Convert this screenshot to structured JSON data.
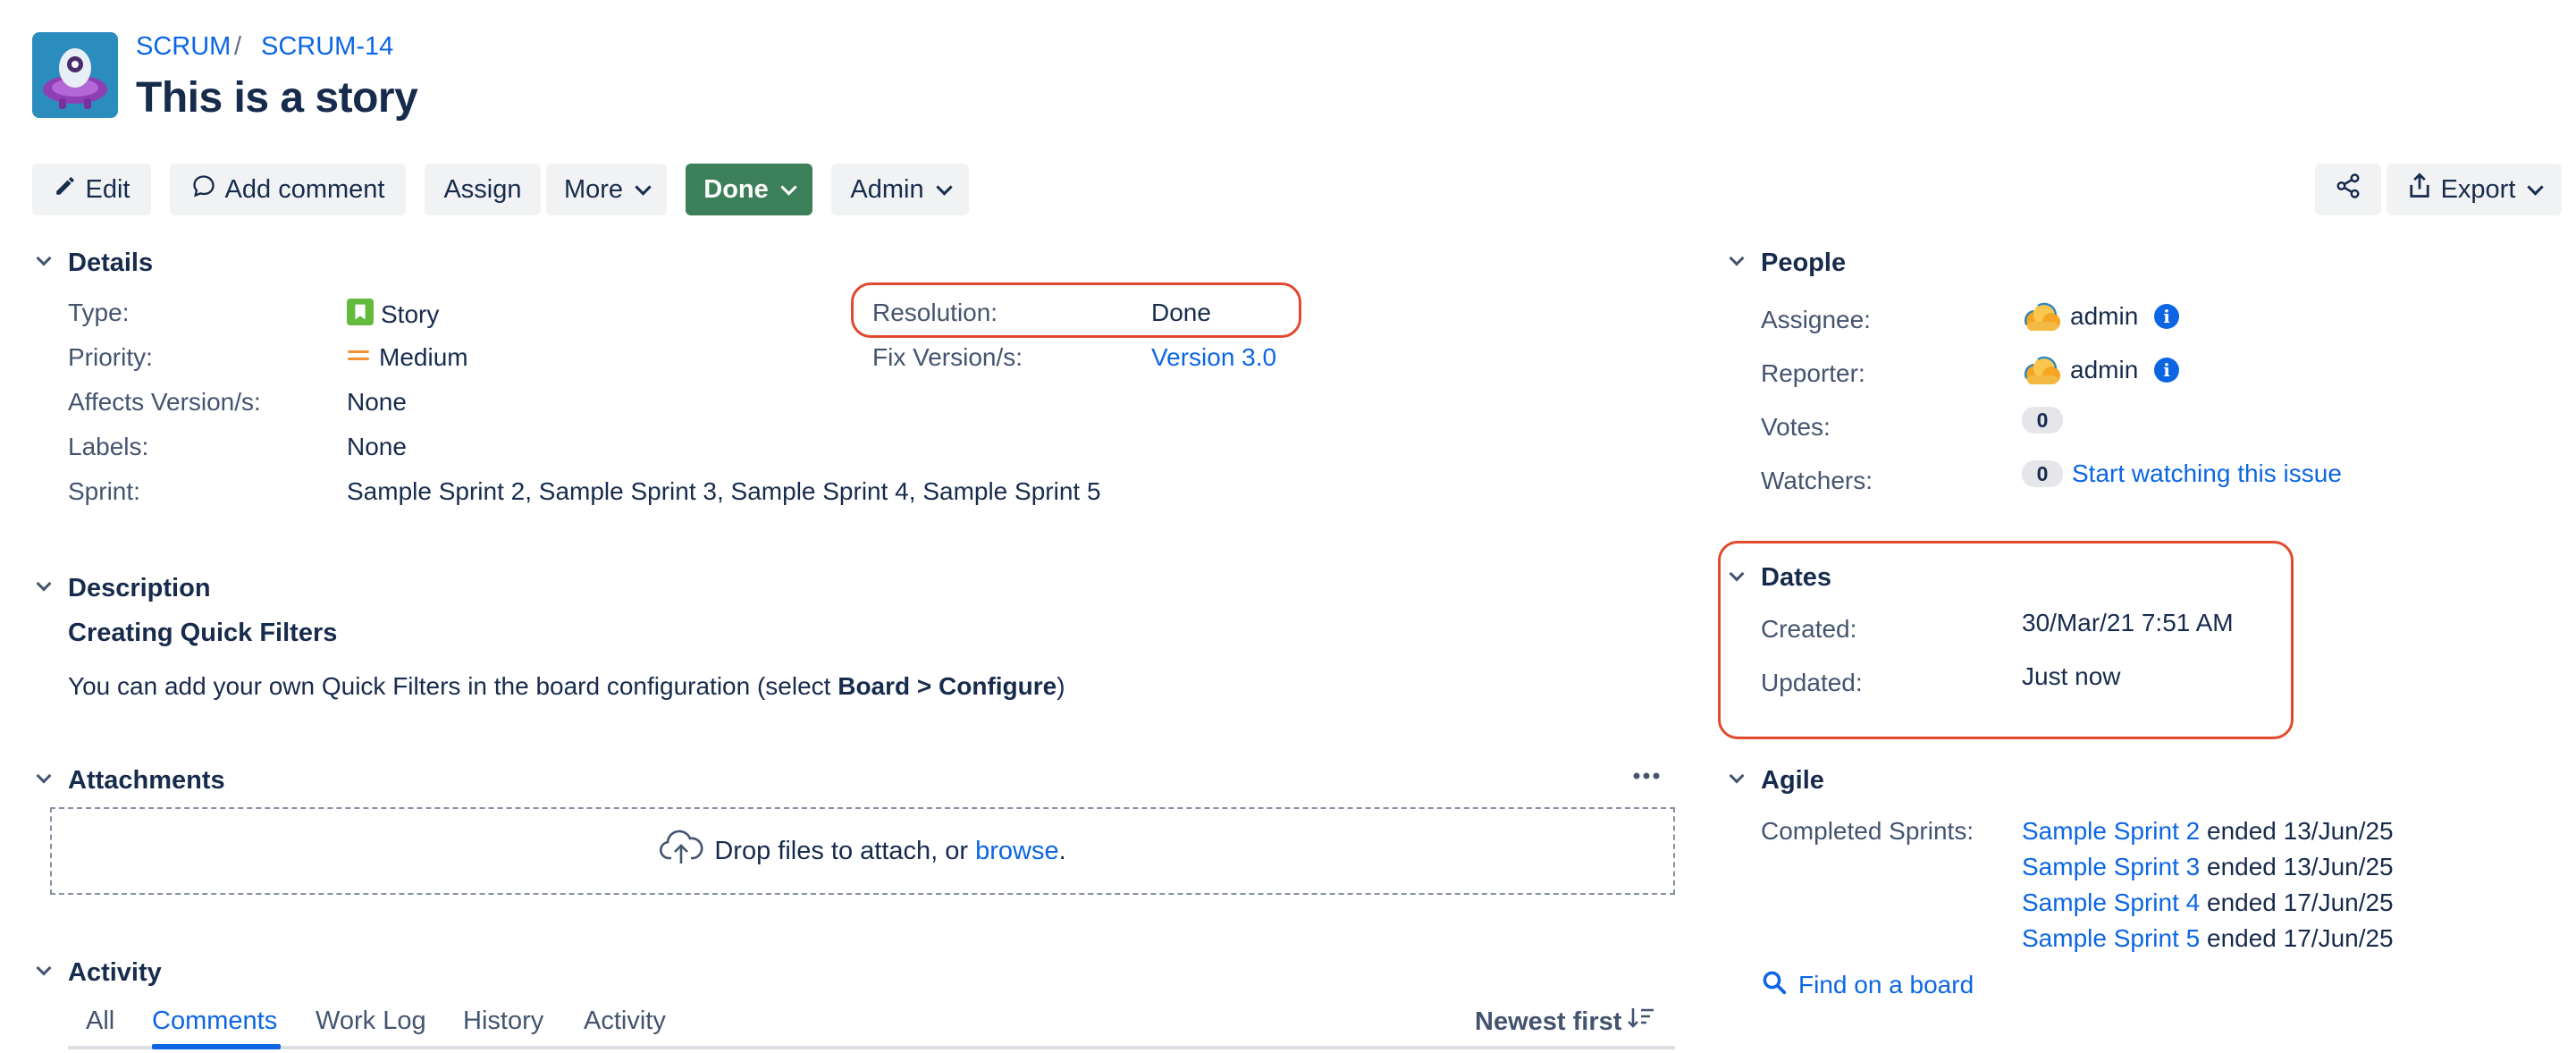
{
  "breadcrumb": {
    "project": "SCRUM",
    "separator": "/",
    "issue_key": "SCRUM-14"
  },
  "issue": {
    "title": "This is a story"
  },
  "toolbar": {
    "edit": "Edit",
    "add_comment": "Add comment",
    "assign": "Assign",
    "more": "More",
    "status": "Done",
    "admin": "Admin",
    "export": "Export"
  },
  "details": {
    "heading": "Details",
    "type_label": "Type:",
    "type_value": "Story",
    "priority_label": "Priority:",
    "priority_value": "Medium",
    "affects_label": "Affects Version/s:",
    "affects_value": "None",
    "labels_label": "Labels:",
    "labels_value": "None",
    "sprint_label": "Sprint:",
    "sprint_value": "Sample Sprint 2, Sample Sprint 3, Sample Sprint 4, Sample Sprint 5",
    "resolution_label": "Resolution:",
    "resolution_value": "Done",
    "fix_label": "Fix Version/s:",
    "fix_value": "Version 3.0"
  },
  "description": {
    "heading": "Description",
    "subheading": "Creating Quick Filters",
    "text_before": "You can add your own Quick Filters in the board configuration (select ",
    "text_bold": "Board > Configure",
    "text_after": ")"
  },
  "attachments": {
    "heading": "Attachments",
    "drop_text": "Drop files to attach, or ",
    "browse": "browse",
    "period": "."
  },
  "activity": {
    "heading": "Activity",
    "tabs": [
      "All",
      "Comments",
      "Work Log",
      "History",
      "Activity"
    ],
    "active_tab": "Comments",
    "sort": "Newest first"
  },
  "people": {
    "heading": "People",
    "assignee_label": "Assignee:",
    "assignee_value": "admin",
    "reporter_label": "Reporter:",
    "reporter_value": "admin",
    "votes_label": "Votes:",
    "votes_count": "0",
    "watchers_label": "Watchers:",
    "watchers_count": "0",
    "watch_link": "Start watching this issue"
  },
  "dates": {
    "heading": "Dates",
    "created_label": "Created:",
    "created_value": "30/Mar/21 7:51 AM",
    "updated_label": "Updated:",
    "updated_value": "Just now"
  },
  "agile": {
    "heading": "Agile",
    "completed_label": "Completed Sprints:",
    "sprints": [
      {
        "name": "Sample Sprint 2",
        "ended": "ended 13/Jun/25"
      },
      {
        "name": "Sample Sprint 3",
        "ended": "ended 13/Jun/25"
      },
      {
        "name": "Sample Sprint 4",
        "ended": "ended 17/Jun/25"
      },
      {
        "name": "Sample Sprint 5",
        "ended": "ended 17/Jun/25"
      }
    ],
    "find_board": "Find on a board"
  },
  "colors": {
    "accent": "#0c66e4",
    "done": "#3c8059",
    "highlight": "#e2492f"
  },
  "icons": [
    "project-avatar-icon",
    "pencil-icon",
    "comment-icon",
    "share-icon",
    "export-icon",
    "story-icon",
    "medium-priority-icon",
    "info-icon",
    "cloud-upload-icon",
    "search-icon",
    "sort-icon",
    "more-icon"
  ]
}
